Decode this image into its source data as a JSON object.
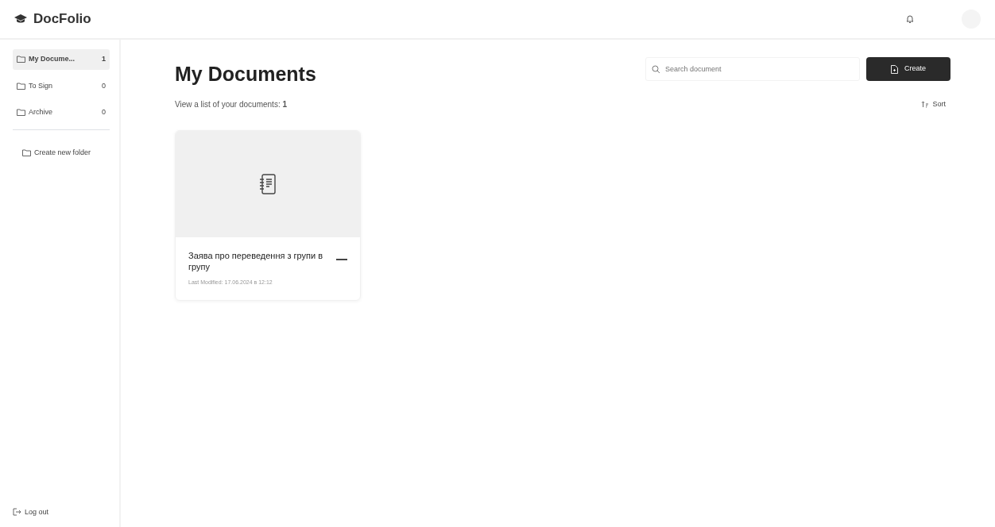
{
  "brand": "DocFolio",
  "sidebar": {
    "items": [
      {
        "label": "My Docume...",
        "count": "1",
        "selected": true
      },
      {
        "label": "To Sign",
        "count": "0",
        "selected": false
      },
      {
        "label": "Archive",
        "count": "0",
        "selected": false
      }
    ],
    "create_folder": "Create new folder",
    "logout": "Log out"
  },
  "page": {
    "title": "My Documents",
    "subtitle": "View a list of your documents:",
    "doc_count": "1",
    "search": {
      "placeholder": "Search document"
    },
    "create_button": "Create",
    "sort_button": "Sort"
  },
  "documents": [
    {
      "title": "Заява про переведення з групи в групу",
      "modified": "Last Modified: 17.06.2024 в 12:12"
    }
  ]
}
